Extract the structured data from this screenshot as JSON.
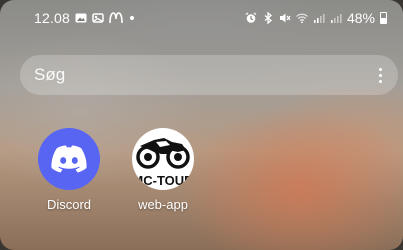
{
  "status_bar": {
    "time": "12.08",
    "left_icons": [
      "photo-icon",
      "gallery-icon",
      "mcdonalds-icon",
      "dot-icon"
    ],
    "right_icons": [
      "alarm-icon",
      "bluetooth-icon",
      "mute-icon",
      "wifi-icon",
      "signal-icon",
      "signal-icon"
    ],
    "battery_percent": "48%"
  },
  "search": {
    "placeholder": "Søg"
  },
  "apps": [
    {
      "label": "Discord",
      "icon": "discord-icon",
      "color": "#5865F2"
    },
    {
      "label": "web-app",
      "icon": "mc-tour-icon",
      "icon_text": "MC-TOUR"
    }
  ]
}
